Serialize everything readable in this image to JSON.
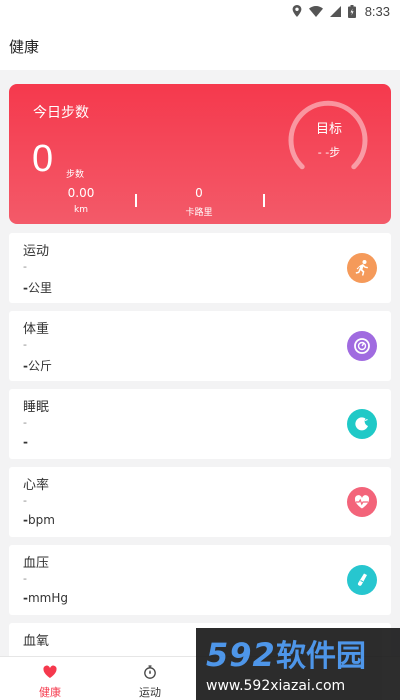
{
  "status_bar": {
    "time": "8:33",
    "icons": [
      "location-icon",
      "wifi-icon",
      "signal-icon",
      "battery-icon"
    ]
  },
  "header": {
    "title": "健康"
  },
  "hero": {
    "title": "今日步数",
    "steps_value": "0",
    "steps_unit": "步数",
    "distance_value": "0.00",
    "distance_unit": "km",
    "calories_value": "0",
    "calories_unit": "卡路里",
    "goal_label": "目标",
    "goal_value": "- -步",
    "gradient_top": "#f5394d",
    "gradient_bottom": "#f35a69"
  },
  "metrics": [
    {
      "title": "运动",
      "dash": "-",
      "value_bold": "-",
      "unit": "公里",
      "icon": "running-icon",
      "color": "#f59a5a"
    },
    {
      "title": "体重",
      "dash": "-",
      "value_bold": "-",
      "unit": "公斤",
      "icon": "scale-icon",
      "color": "#a06be0"
    },
    {
      "title": "睡眠",
      "dash": "-",
      "value_bold": "-",
      "unit": "",
      "icon": "moon-icon",
      "color": "#1fc9c7"
    },
    {
      "title": "心率",
      "dash": "-",
      "value_bold": "-",
      "unit": "bpm",
      "icon": "heart-pulse-icon",
      "color": "#f3647a"
    },
    {
      "title": "血压",
      "dash": "-",
      "value_bold": "-",
      "unit": "mmHg",
      "icon": "test-tube-icon",
      "color": "#27c6cf"
    },
    {
      "title": "血氧",
      "dash": "-",
      "value_bold": "-",
      "unit": "",
      "icon": "",
      "color": ""
    }
  ],
  "bottom_nav": {
    "items": [
      {
        "label": "健康",
        "icon": "heart-icon",
        "active": true
      },
      {
        "label": "运动",
        "icon": "stopwatch-icon",
        "active": false
      }
    ],
    "active_color": "#f5394d"
  },
  "watermark": {
    "brand": "592软件园",
    "url": "www.592xiazai.com"
  }
}
